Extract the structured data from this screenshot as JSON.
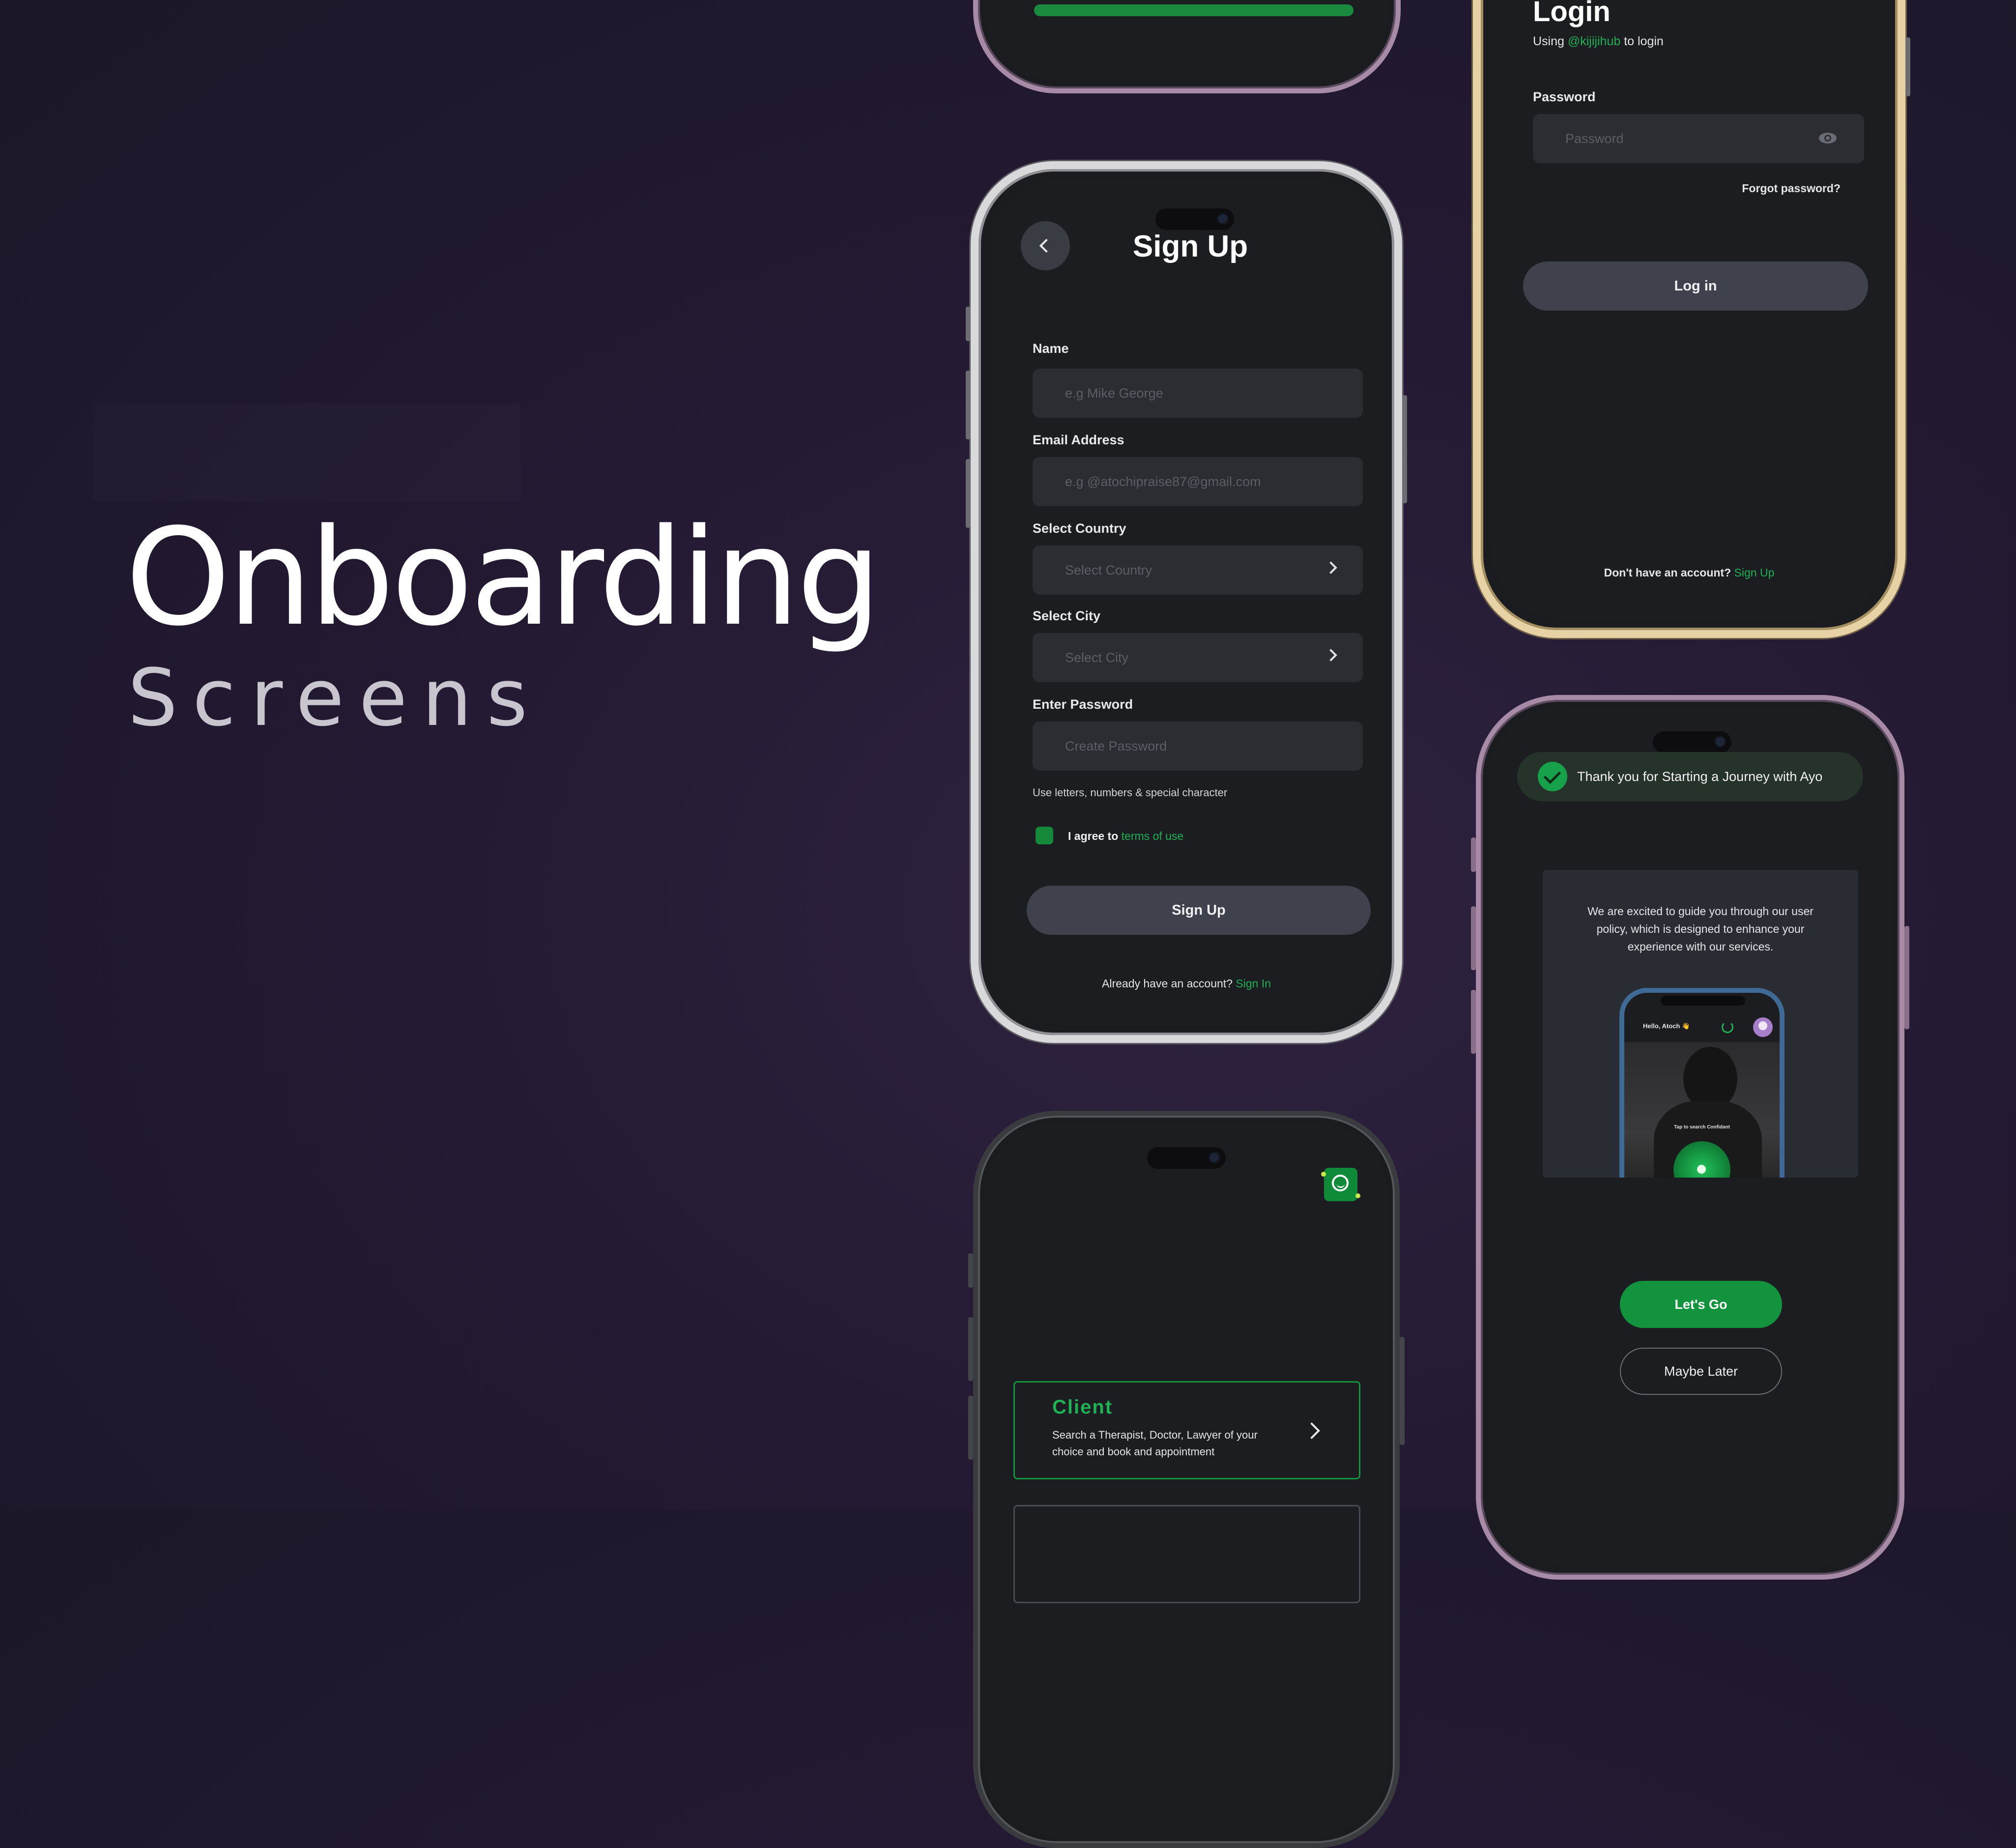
{
  "hero": {
    "title": "Onboarding",
    "subtitle": "Screens"
  },
  "colors": {
    "accent_green": "#1fb154",
    "bg": "#241a33",
    "field": "#2b2d33"
  },
  "signup": {
    "back_icon": "chevron-left-icon",
    "title": "Sign Up",
    "fields": [
      {
        "label": "Name",
        "placeholder": "e.g Mike George"
      },
      {
        "label": "Email Address",
        "placeholder": "e.g @atochipraise87@gmail.com"
      },
      {
        "label": "Select Country",
        "placeholder": "Select Country"
      },
      {
        "label": "Select City",
        "placeholder": "Select City"
      },
      {
        "label": "Enter Password",
        "placeholder": "Create Password"
      }
    ],
    "password_hint": "Use letters, numbers & special character",
    "agree_text": "I agree to",
    "terms_link": "terms of use",
    "submit_label": "Sign Up",
    "footer_text": "Already have an account?",
    "footer_link": "Sign In"
  },
  "login": {
    "title": "Login",
    "using_prefix": "Using",
    "using_handle": "@kijijihub",
    "using_suffix": "to login",
    "password_label": "Password",
    "password_placeholder": "Password",
    "forgot": "Forgot password?",
    "submit_label": "Log in",
    "footer_text": "Don't have an account?",
    "footer_link": "Sign Up"
  },
  "welcome": {
    "banner": "Thank you for Starting a Journey with Ayo",
    "body": "We are excited to guide you through our user policy, which is designed to enhance your experience with our services.",
    "mini_greeting": "Hello, Atoch 👋",
    "mini_caption": "Tap to search Confidant",
    "primary": "Let's Go",
    "secondary": "Maybe Later"
  },
  "role": {
    "title": "Client",
    "description": "Search a Therapist, Doctor, Lawyer of your choice and book and appointment"
  }
}
